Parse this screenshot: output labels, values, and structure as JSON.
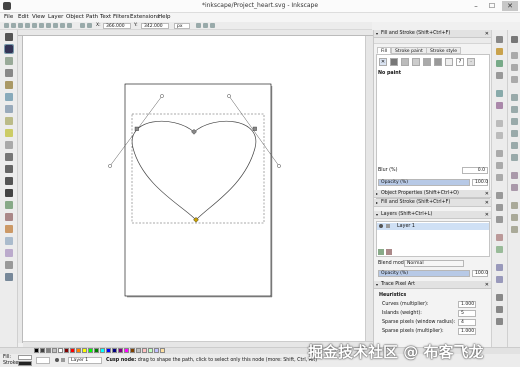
{
  "window": {
    "title": "*inkscape/Project_heart.svg - Inkscape",
    "min": "–",
    "max": "☐",
    "close": "✕"
  },
  "menu": [
    "File",
    "Edit",
    "View",
    "Layer",
    "Object",
    "Path",
    "Text",
    "Filters",
    "Extensions",
    "Help"
  ],
  "toolbar": {
    "x_label": "X:",
    "x_value": "366.000",
    "y_label": "Y:",
    "y_value": "342.000",
    "unit": "px"
  },
  "fill_stroke": {
    "title": "Fill and Stroke (Shift+Ctrl+F)",
    "tabs": [
      "Fill",
      "Stroke paint",
      "Stroke style"
    ],
    "paint_buttons": [
      "✕",
      "",
      "",
      "",
      "",
      "",
      "",
      "?",
      "·"
    ],
    "no_paint": "No paint",
    "blur_label": "Blur (%)",
    "blur_value": "0.0",
    "opacity_label": "Opacity (%)",
    "opacity_value": "100.0",
    "opacity_fraction": 1.0
  },
  "collapsed_panels": [
    "Object Properties (Shift+Ctrl+O)",
    "Fill and Stroke (Shift+Ctrl+F)"
  ],
  "layers": {
    "title": "Layers (Shift+Ctrl+L)",
    "items": [
      "Layer 1"
    ],
    "blend_label": "Blend mode",
    "blend_value": "Normal",
    "opacity_label": "Opacity (%)",
    "opacity_value": "100.0",
    "opacity_fraction": 1.0
  },
  "trace": {
    "title": "Trace Pixel Art",
    "heuristics": "Heuristics",
    "rows": [
      {
        "label": "Curves (multiplier):",
        "value": "1.000"
      },
      {
        "label": "Islands (weight):",
        "value": "5"
      },
      {
        "label": "Sparse pixels (window radius):",
        "value": "4"
      },
      {
        "label": "Sparse pixels (multiplier):",
        "value": "1.000"
      }
    ]
  },
  "status": {
    "fill_label": "Fill:",
    "stroke_label": "Stroke:",
    "layer_value": "Layer 1",
    "message_bold": "Cusp node:",
    "message": " drag to shape the path, click to select only this node (more: Shift, Ctrl, Alt)",
    "palette": [
      "#000000",
      "#404040",
      "#808080",
      "#bfbfbf",
      "#ffffff",
      "#800000",
      "#ff0000",
      "#ff8000",
      "#ffff00",
      "#00ff00",
      "#008000",
      "#00ffff",
      "#0000ff",
      "#000080",
      "#800080",
      "#ff00ff",
      "#804000",
      "#c0c0c0",
      "#ffc0c0",
      "#c0ffc0",
      "#c0c0ff",
      "#ffe0a0"
    ]
  },
  "watermark": "掘金技术社区 @ 布客飞龙",
  "icons": [
    "app-icon",
    "selector-tool-icon",
    "node-tool-icon",
    "zoom-tool-icon",
    "pencil-tool-icon",
    "text-tool-icon",
    "dropper-tool-icon",
    "close-icon",
    "layer-eye-icon",
    "layer-lock-icon",
    "add-layer-icon"
  ]
}
